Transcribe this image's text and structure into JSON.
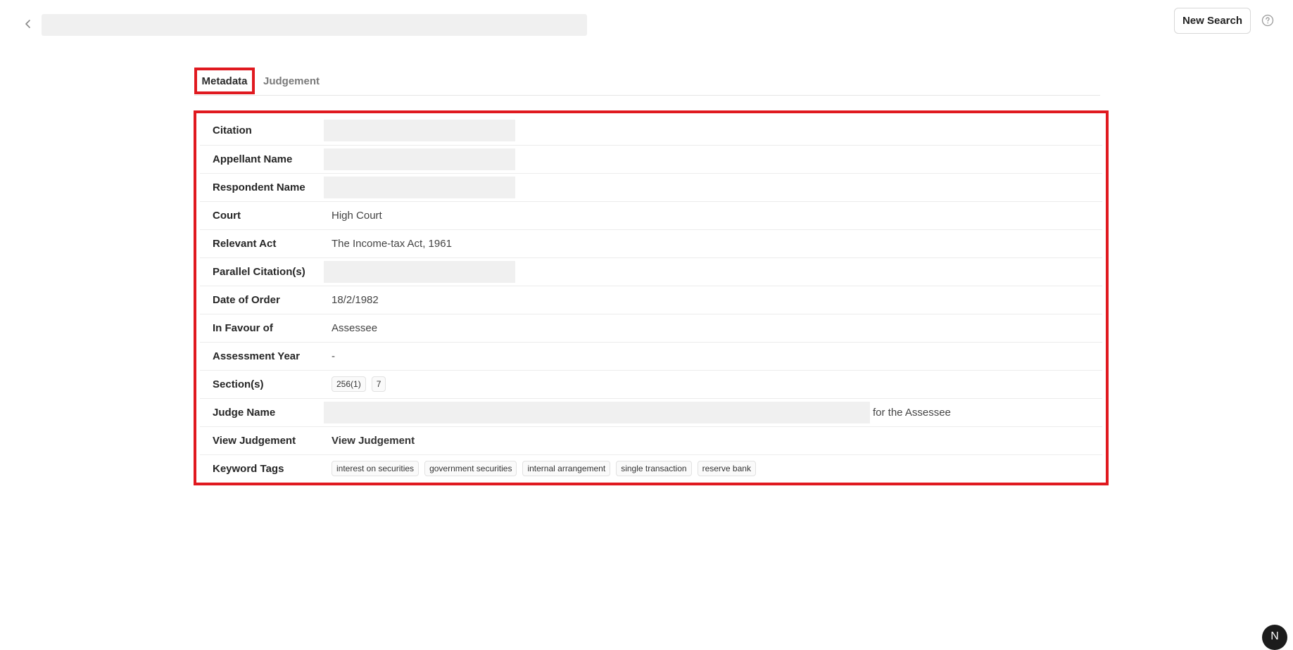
{
  "header": {
    "new_search_label": "New Search"
  },
  "tabs": [
    {
      "label": "Metadata",
      "active": true
    },
    {
      "label": "Judgement",
      "active": false
    }
  ],
  "metadata": {
    "citation": {
      "label": "Citation",
      "value": ""
    },
    "appellant": {
      "label": "Appellant Name",
      "value": ""
    },
    "respondent": {
      "label": "Respondent Name",
      "value": ""
    },
    "court": {
      "label": "Court",
      "value": "High Court"
    },
    "relevant_act": {
      "label": "Relevant Act",
      "value": "The Income-tax Act, 1961"
    },
    "parallel_citations": {
      "label": "Parallel Citation(s)",
      "value": ""
    },
    "date_of_order": {
      "label": "Date of Order",
      "value": "18/2/1982"
    },
    "in_favour_of": {
      "label": "In Favour of",
      "value": "Assessee"
    },
    "assessment_year": {
      "label": "Assessment Year",
      "value": "-"
    },
    "sections": {
      "label": "Section(s)",
      "values": [
        "256(1)",
        "7"
      ]
    },
    "judge_name": {
      "label": "Judge Name",
      "suffix": "for the Assessee"
    },
    "view_judgement": {
      "label": "View Judgement",
      "link_text": "View Judgement"
    },
    "keyword_tags": {
      "label": "Keyword Tags",
      "values": [
        "interest on securities",
        "government securities",
        "internal arrangement",
        "single transaction",
        "reserve bank"
      ]
    }
  },
  "floating_badge": {
    "letter": "N"
  },
  "colors": {
    "highlight": "#e0191f",
    "redacted": "#f0f0f0"
  }
}
